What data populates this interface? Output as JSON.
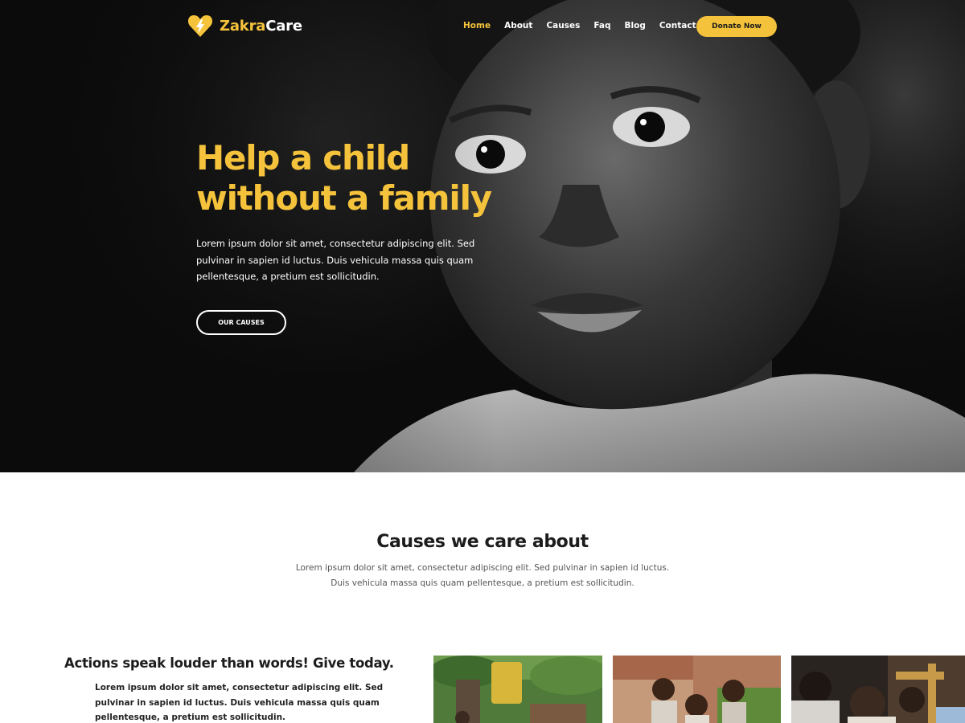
{
  "nav": {
    "logo": {
      "part1": "Zakra",
      "part2": "Care",
      "icon": "heart-bolt-icon"
    },
    "items": [
      {
        "label": "Home",
        "active": true
      },
      {
        "label": "About",
        "active": false
      },
      {
        "label": "Causes",
        "active": false
      },
      {
        "label": "Faq",
        "active": false
      },
      {
        "label": "Blog",
        "active": false
      },
      {
        "label": "Contact",
        "active": false
      }
    ],
    "donate_label": "Donate Now"
  },
  "hero": {
    "title_line1": "Help a child",
    "title_line2": "without a family",
    "text": "Lorem ipsum dolor sit amet, consectetur adipiscing elit. Sed pulvinar in sapien id luctus. Duis vehicula massa quis quam pellentesque, a pretium est sollicitudin.",
    "button_label": "OUR CAUSES"
  },
  "causes": {
    "title": "Causes we care about",
    "text": "Lorem ipsum dolor sit amet, consectetur adipiscing elit. Sed pulvinar in sapien id luctus. Duis vehicula massa quis quam pellentesque, a pretium est sollicitudin."
  },
  "actions": {
    "title": "Actions speak louder than words! Give today.",
    "text": "Lorem ipsum dolor sit amet, consectetur adipiscing elit. Sed pulvinar in sapien id luctus. Duis vehicula massa quis quam pellentesque, a pretium est sollicitudin."
  },
  "colors": {
    "accent": "#f5c33b",
    "hero_bg": "#0d0d0d",
    "text_dark": "#1c1c1c"
  }
}
